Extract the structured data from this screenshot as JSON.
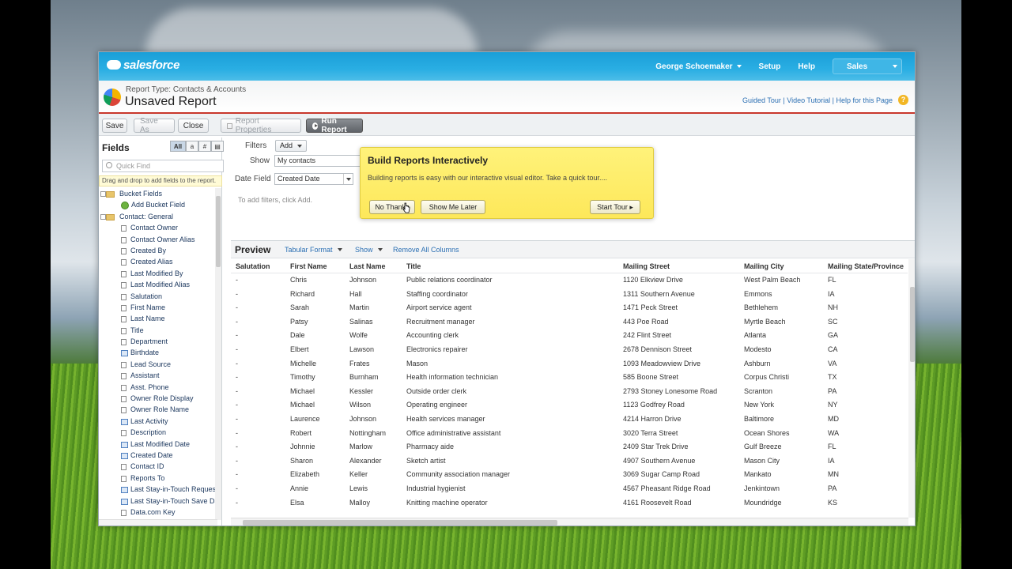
{
  "header": {
    "brand": "salesforce",
    "user": "George Schoemaker",
    "setup": "Setup",
    "help": "Help",
    "app": "Sales"
  },
  "report": {
    "type_label": "Report Type: Contacts & Accounts",
    "title": "Unsaved Report",
    "help_links": "Guided Tour | Video Tutorial | Help for this Page"
  },
  "toolbar": {
    "save": "Save",
    "save_as": "Save As",
    "close": "Close",
    "properties": "Report Properties",
    "run": "Run Report"
  },
  "fields_panel": {
    "title": "Fields",
    "toggle": [
      "All",
      "a",
      "#",
      "▤"
    ],
    "quick_find_placeholder": "Quick Find",
    "drag_tip": "Drag and drop to add fields to the report.",
    "tree": [
      {
        "kind": "folder",
        "label": "Bucket Fields"
      },
      {
        "kind": "add",
        "label": "Add Bucket Field"
      },
      {
        "kind": "folder",
        "label": "Contact: General"
      },
      {
        "kind": "leaf",
        "label": "Contact Owner"
      },
      {
        "kind": "leaf",
        "label": "Contact Owner Alias"
      },
      {
        "kind": "leaf",
        "label": "Created By"
      },
      {
        "kind": "leaf",
        "label": "Created Alias"
      },
      {
        "kind": "leaf",
        "label": "Last Modified By"
      },
      {
        "kind": "leaf",
        "label": "Last Modified Alias"
      },
      {
        "kind": "leaf",
        "label": "Salutation"
      },
      {
        "kind": "leaf",
        "label": "First Name"
      },
      {
        "kind": "leaf",
        "label": "Last Name"
      },
      {
        "kind": "leaf",
        "label": "Title"
      },
      {
        "kind": "leaf",
        "label": "Department"
      },
      {
        "kind": "cal",
        "label": "Birthdate"
      },
      {
        "kind": "leaf",
        "label": "Lead Source"
      },
      {
        "kind": "leaf",
        "label": "Assistant"
      },
      {
        "kind": "leaf",
        "label": "Asst. Phone"
      },
      {
        "kind": "leaf",
        "label": "Owner Role Display"
      },
      {
        "kind": "leaf",
        "label": "Owner Role Name"
      },
      {
        "kind": "cal",
        "label": "Last Activity"
      },
      {
        "kind": "leaf",
        "label": "Description"
      },
      {
        "kind": "cal",
        "label": "Last Modified Date"
      },
      {
        "kind": "cal",
        "label": "Created Date"
      },
      {
        "kind": "leaf",
        "label": "Contact ID"
      },
      {
        "kind": "leaf",
        "label": "Reports To"
      },
      {
        "kind": "cal",
        "label": "Last Stay-in-Touch Request"
      },
      {
        "kind": "cal",
        "label": "Last Stay-in-Touch Save Dat"
      },
      {
        "kind": "leaf",
        "label": "Data.com Key"
      }
    ]
  },
  "filters": {
    "filters_label": "Filters",
    "add": "Add",
    "show_label": "Show",
    "show_value": "My contacts",
    "date_field_label": "Date Field",
    "date_field_value": "Created Date",
    "hint": "To add filters, click Add."
  },
  "tour": {
    "title": "Build Reports Interactively",
    "text": "Building reports is easy with our interactive visual editor. Take a quick tour....",
    "no_thanks": "No Thanks",
    "later": "Show Me Later",
    "start": "Start Tour ▸"
  },
  "preview": {
    "title": "Preview",
    "format": "Tabular Format",
    "show": "Show",
    "remove": "Remove All Columns",
    "columns": [
      "Salutation",
      "First Name",
      "Last Name",
      "Title",
      "Mailing Street",
      "Mailing City",
      "Mailing State/Province"
    ],
    "rows": [
      [
        "-",
        "Chris",
        "Johnson",
        "Public relations coordinator",
        "1120 Elkview Drive",
        "West Palm Beach",
        "FL"
      ],
      [
        "-",
        "Richard",
        "Hall",
        "Staffing coordinator",
        "1311 Southern Avenue",
        "Emmons",
        "IA"
      ],
      [
        "-",
        "Sarah",
        "Martin",
        "Airport service agent",
        "1471 Peck Street",
        "Bethlehem",
        "NH"
      ],
      [
        "-",
        "Patsy",
        "Salinas",
        "Recruitment manager",
        "443 Poe Road",
        "Myrtle Beach",
        "SC"
      ],
      [
        "-",
        "Dale",
        "Wolfe",
        "Accounting clerk",
        "242 Flint Street",
        "Atlanta",
        "GA"
      ],
      [
        "-",
        "Elbert",
        "Lawson",
        "Electronics repairer",
        "2678 Dennison Street",
        "Modesto",
        "CA"
      ],
      [
        "-",
        "Michelle",
        "Frates",
        "Mason",
        "1093 Meadowview Drive",
        "Ashburn",
        "VA"
      ],
      [
        "-",
        "Timothy",
        "Burnham",
        "Health information technician",
        "585 Boone Street",
        "Corpus Christi",
        "TX"
      ],
      [
        "-",
        "Michael",
        "Kessler",
        "Outside order clerk",
        "2793 Stoney Lonesome Road",
        "Scranton",
        "PA"
      ],
      [
        "-",
        "Michael",
        "Wilson",
        "Operating engineer",
        "1123 Godfrey Road",
        "New York",
        "NY"
      ],
      [
        "-",
        "Laurence",
        "Johnson",
        "Health services manager",
        "4214 Harron Drive",
        "Baltimore",
        "MD"
      ],
      [
        "-",
        "Robert",
        "Nottingham",
        "Office administrative assistant",
        "3020 Terra Street",
        "Ocean Shores",
        "WA"
      ],
      [
        "-",
        "Johnnie",
        "Marlow",
        "Pharmacy aide",
        "2409 Star Trek Drive",
        "Gulf Breeze",
        "FL"
      ],
      [
        "-",
        "Sharon",
        "Alexander",
        "Sketch artist",
        "4907 Southern Avenue",
        "Mason City",
        "IA"
      ],
      [
        "-",
        "Elizabeth",
        "Keller",
        "Community association manager",
        "3069 Sugar Camp Road",
        "Mankato",
        "MN"
      ],
      [
        "-",
        "Annie",
        "Lewis",
        "Industrial hygienist",
        "4567 Pheasant Ridge Road",
        "Jenkintown",
        "PA"
      ],
      [
        "-",
        "Elsa",
        "Malloy",
        "Knitting machine operator",
        "4161 Roosevelt Road",
        "Moundridge",
        "KS"
      ]
    ]
  },
  "colors": {
    "topbar": "#1a9fd8",
    "accent_red": "#c8372b",
    "tour_yellow": "#fde85a",
    "link": "#2b6fb3"
  }
}
